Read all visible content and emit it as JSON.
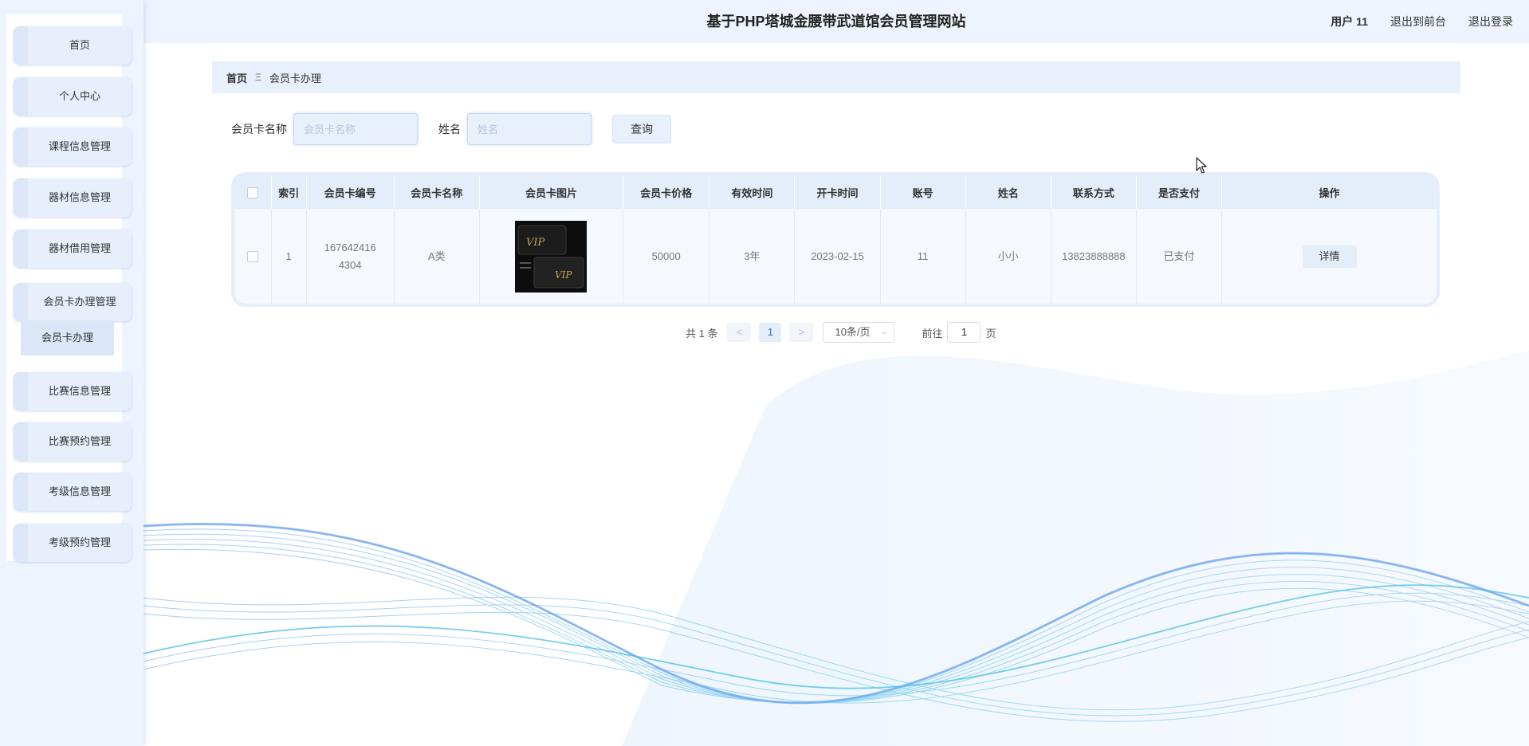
{
  "header": {
    "title": "基于PHP塔城金腰带武道馆会员管理网站",
    "user": "用户 11",
    "to_front": "退出到前台",
    "logout": "退出登录"
  },
  "sidebar": {
    "items": [
      {
        "label": "首页"
      },
      {
        "label": "个人中心"
      },
      {
        "label": "课程信息管理"
      },
      {
        "label": "器材信息管理"
      },
      {
        "label": "器材借用管理"
      },
      {
        "label": "会员卡办理管理"
      },
      {
        "label": "比赛信息管理"
      },
      {
        "label": "比赛预约管理"
      },
      {
        "label": "考级信息管理"
      },
      {
        "label": "考级预约管理"
      }
    ],
    "submenu": {
      "label": "会员卡办理"
    }
  },
  "breadcrumb": {
    "home": "首页",
    "separator": "Ξ",
    "current": "会员卡办理"
  },
  "search": {
    "card_name_label": "会员卡名称",
    "card_name_placeholder": "会员卡名称",
    "name_label": "姓名",
    "name_placeholder": "姓名",
    "query_button": "查询"
  },
  "table": {
    "headers": [
      "索引",
      "会员卡编号",
      "会员卡名称",
      "会员卡图片",
      "会员卡价格",
      "有效时间",
      "开卡时间",
      "账号",
      "姓名",
      "联系方式",
      "是否支付",
      "操作"
    ],
    "rows": [
      {
        "index": "1",
        "card_no": "1676424164304",
        "card_name": "A类",
        "card_price": "50000",
        "valid_time": "3年",
        "open_date": "2023-02-15",
        "account": "11",
        "name": "小小",
        "phone": "13823888888",
        "paid": "已支付",
        "action": "详情"
      }
    ]
  },
  "pagination": {
    "total": "共 1 条",
    "prev": "<",
    "current_page": "1",
    "next": ">",
    "page_size": "10条/页",
    "goto_prefix": "前往",
    "goto_value": "1",
    "goto_suffix": "页"
  },
  "colors": {
    "sidebar_bg": "#eef4fd",
    "header_bg": "#eef4fd",
    "accent": "#3a6fd1",
    "table_header_bg": "#e4edfa"
  }
}
